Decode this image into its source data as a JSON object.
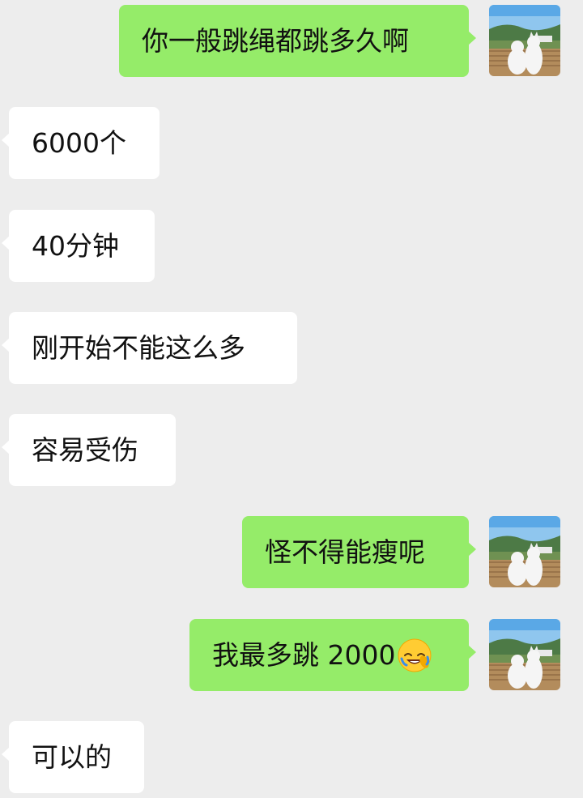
{
  "messages": [
    {
      "side": "out",
      "text": "你一般跳绳都跳多久啊",
      "avatar": true
    },
    {
      "side": "in",
      "text": "6000个"
    },
    {
      "side": "in",
      "text": "40分钟"
    },
    {
      "side": "in",
      "text": "刚开始不能这么多"
    },
    {
      "side": "in",
      "text": "容易受伤"
    },
    {
      "side": "out",
      "text": "怪不得能瘦呢",
      "avatar": true
    },
    {
      "side": "out",
      "text": "我最多跳 2000",
      "emoji": "facepalm-laugh-emoji",
      "avatar": true
    },
    {
      "side": "in",
      "text": "可以的"
    }
  ],
  "colors": {
    "background": "#ededed",
    "outgoing_bubble": "#95ec69",
    "incoming_bubble": "#ffffff",
    "text": "#111111"
  },
  "avatar_icon": "two-dogs-landscape-avatar"
}
